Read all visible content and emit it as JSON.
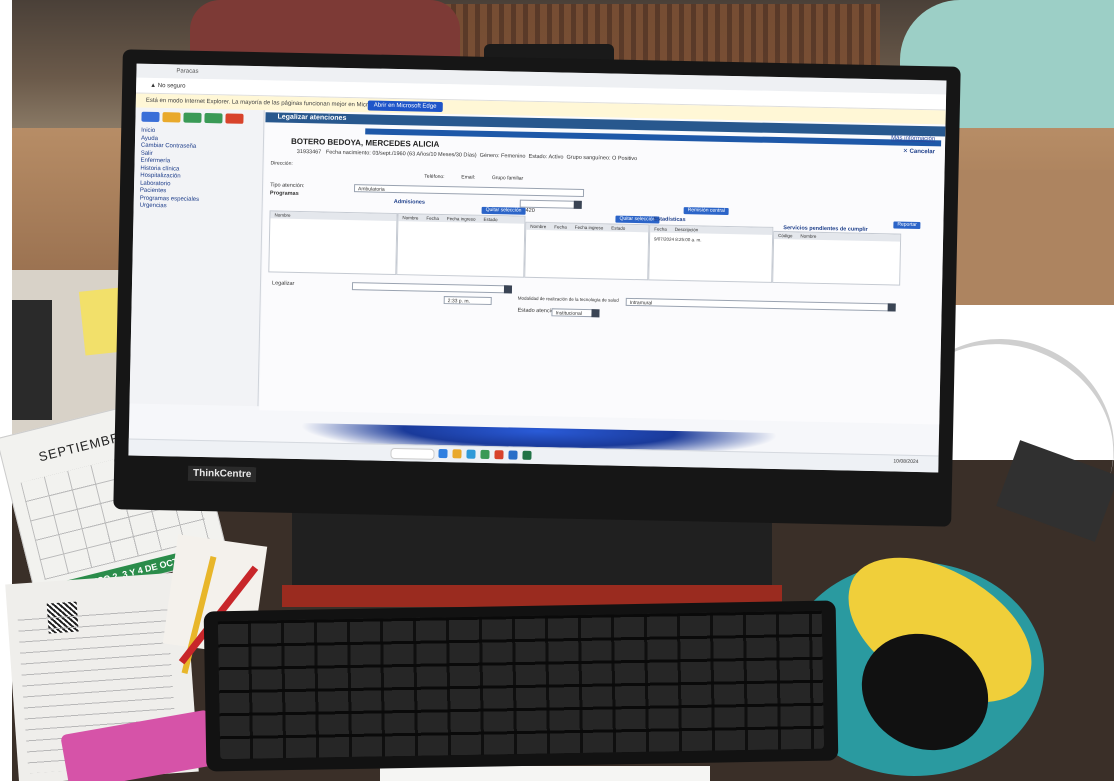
{
  "browser": {
    "tab": "Paracas",
    "address": "No seguro",
    "edge_note": "Está en modo Internet Explorer. La mayoría de las páginas funcionan mejor en Microsoft Edge.",
    "edge_button": "Abrir en Microsoft Edge"
  },
  "sidebar": {
    "menu": [
      "Inicio",
      "Ayuda",
      "Cambiar Contraseña",
      "Salir",
      "Enfermería",
      "Historia clínica",
      "Hospitalización",
      "Laboratorio",
      "Pacientes",
      "Programas especiales",
      "Urgencias"
    ]
  },
  "form": {
    "title": "Legalizar atenciones",
    "help_link": "Más información",
    "cancel": "Cancelar",
    "patient_name": "BOTERO BEDOYA, MERCEDES ALICIA",
    "birth_label": "Fecha nacimiento:",
    "birth_value": "03/sept./1960 (63 Años/10 Meses/30 Días)",
    "gender_label": "Género:",
    "gender_value": "Femenino",
    "document": "31933467",
    "state_label": "Estado:",
    "state_value": "Activo",
    "group_label": "Grupo sanguíneo:",
    "group_value": "O Positivo",
    "address_label": "Dirección:",
    "phone_label": "Teléfono:",
    "email_label": "Email:",
    "family_group_label": "Grupo familiar",
    "attention_type_label": "Tipo atención:",
    "attention_type_value": "Ambulatoria",
    "programs_label": "Programas",
    "admissions_label": "Admisiones",
    "quit_selection": "Quitar selección",
    "quit_selection_2": "Quitar selección",
    "admission_code": "420",
    "central_requests": "Remisión central",
    "statistics_label": "Estadísticas",
    "report_button": "Reportar",
    "pending_services": "Servicios pendientes de cumplir",
    "grid_cols_1": [
      "Nombre",
      "Fecha",
      "Fecha ingreso",
      "Estado"
    ],
    "grid_cols_2": [
      "Nombre",
      "Fecha",
      "Fecha ingreso",
      "Estado"
    ],
    "grid_cols_3": [
      "Fecha",
      "Descripción"
    ],
    "grid_cols_4": [
      "Código",
      "Nombre"
    ],
    "stat_date": "9/07/2024 8:25:00 a. m.",
    "legalize_label": "Legalizar",
    "mode_label": "Modalidad de realización de la tecnología de salud",
    "mode_value": "Intramural",
    "attention_state_label": "Estado atención",
    "attention_state_value": "Institucional",
    "time_value": "2:33 p. m."
  },
  "taskbar": {
    "clock": "10/08/2024"
  },
  "monitor": {
    "brand": "ThinkCentre"
  },
  "calendar": {
    "month": "SEPTIEMBRE",
    "banner": "CONGRESO 2, 3 Y 4 DE OCTUBRE"
  }
}
